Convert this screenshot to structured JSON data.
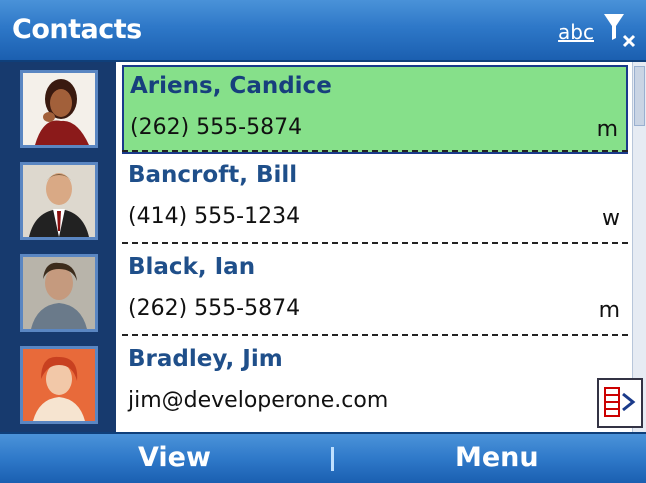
{
  "header": {
    "title": "Contacts",
    "abc_label": "abc",
    "filter_icon": "filter-clear-icon"
  },
  "contacts": [
    {
      "name": "Ariens, Candice",
      "detail": "(262) 555-5874",
      "type": "m",
      "selected": true
    },
    {
      "name": "Bancroft, Bill",
      "detail": "(414) 555-1234",
      "type": "w",
      "selected": false
    },
    {
      "name": "Black, Ian",
      "detail": "(262) 555-5874",
      "type": "m",
      "selected": false
    },
    {
      "name": "Bradley, Jim",
      "detail": "jim@developerone.com",
      "type": "",
      "selected": false
    }
  ],
  "softkeys": {
    "left": "View",
    "right": "Menu"
  },
  "colors": {
    "selection": "#86e08a",
    "header": "#2e78c8",
    "name_text": "#1f4f8a"
  }
}
